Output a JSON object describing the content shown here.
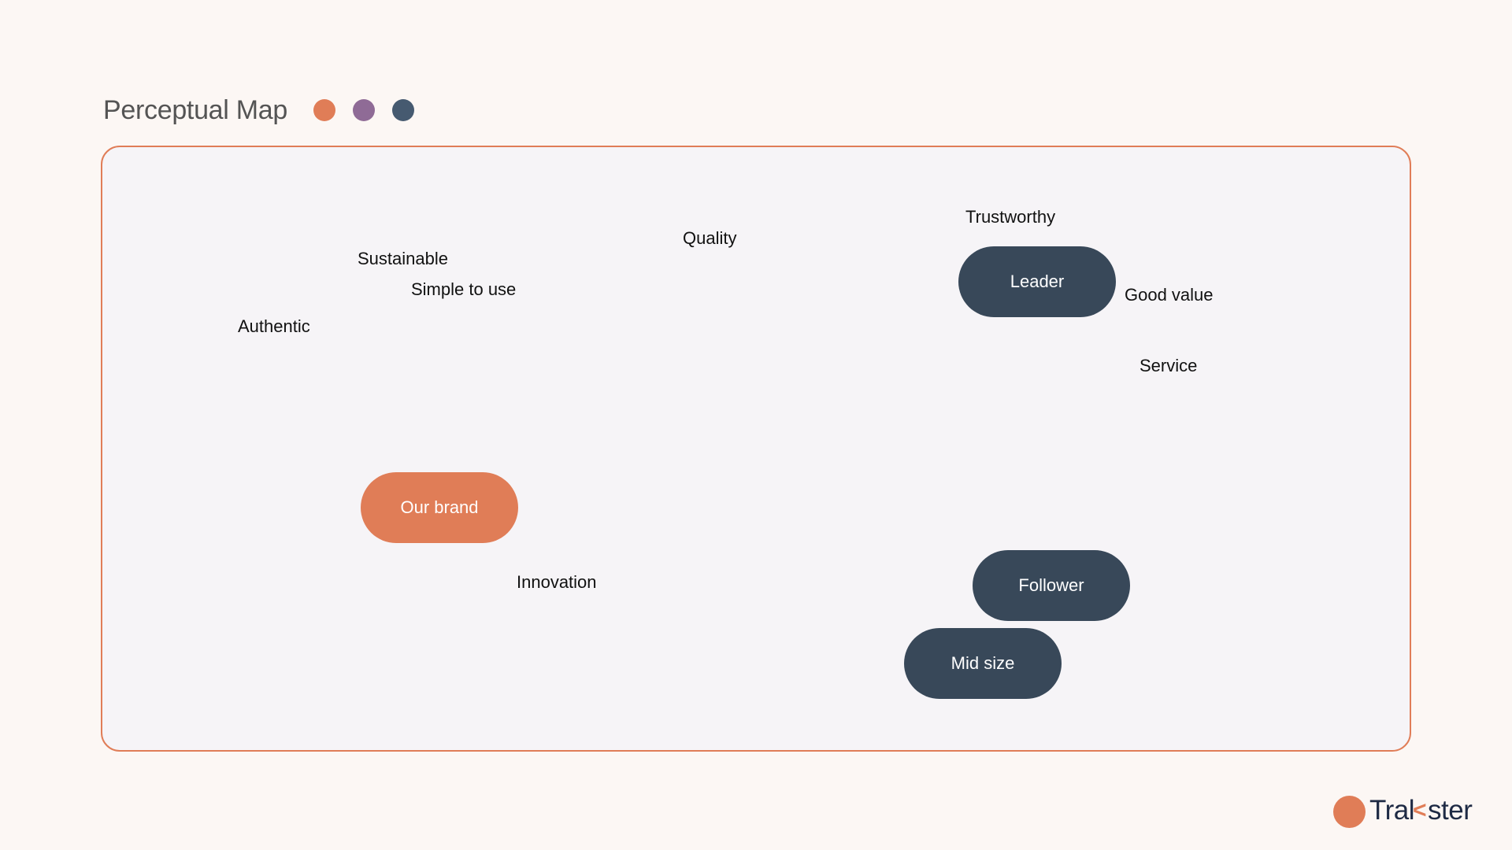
{
  "header": {
    "title": "Perceptual Map",
    "legend_dots": [
      {
        "name": "orange",
        "color": "#E07D57"
      },
      {
        "name": "purple",
        "color": "#8F6B96"
      },
      {
        "name": "slate",
        "color": "#465A70"
      }
    ]
  },
  "map": {
    "border_color": "#E07D57",
    "attributes": [
      {
        "label": "Trustworthy"
      },
      {
        "label": "Quality"
      },
      {
        "label": "Sustainable"
      },
      {
        "label": "Simple to use"
      },
      {
        "label": "Authentic"
      },
      {
        "label": "Good value"
      },
      {
        "label": "Service"
      },
      {
        "label": "Innovation"
      }
    ],
    "brands": [
      {
        "label": "Leader",
        "color": "#384859"
      },
      {
        "label": "Our brand",
        "color": "#E07D57"
      },
      {
        "label": "Follower",
        "color": "#384859"
      },
      {
        "label": "Mid size",
        "color": "#384859"
      }
    ]
  },
  "logo": {
    "text_before": "Tra",
    "k_stem": "l",
    "chevron": "<",
    "text_after": "ster",
    "circle_color": "#E07D57",
    "chevron_color": "#E07D57"
  }
}
